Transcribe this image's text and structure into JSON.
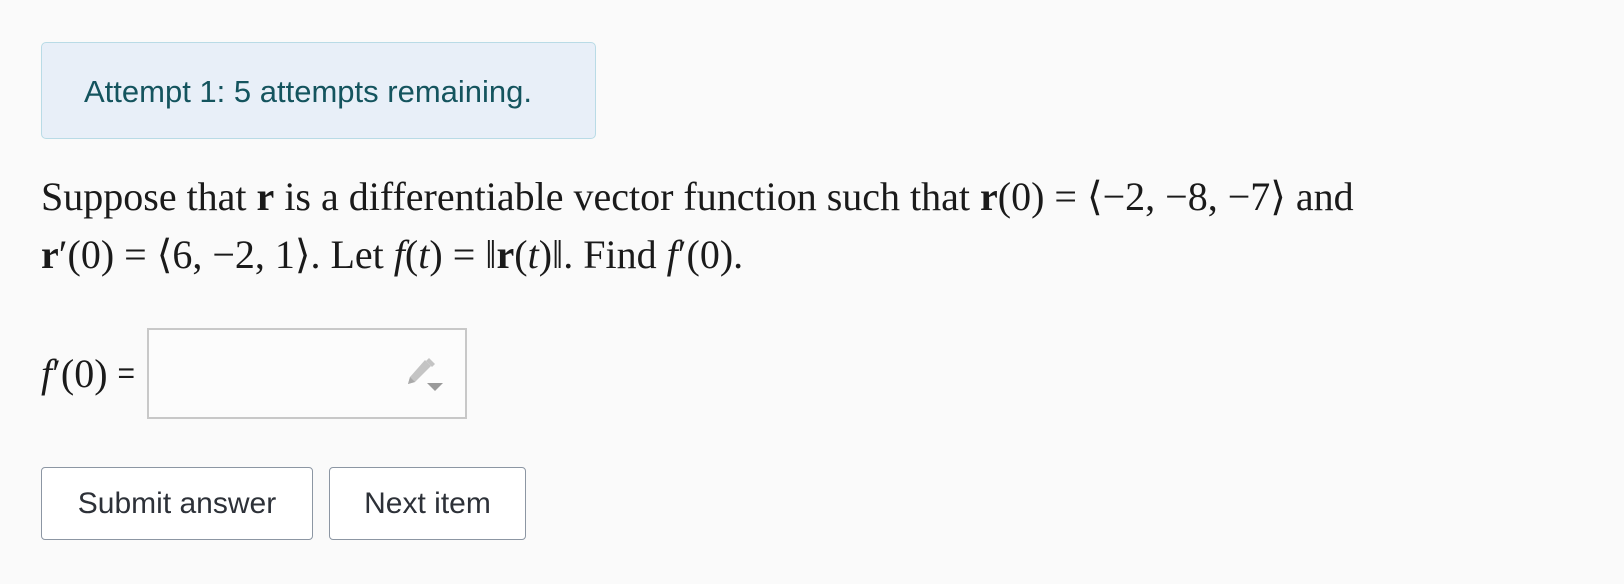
{
  "alert": {
    "text": "Attempt 1: 5 attempts remaining."
  },
  "question": {
    "line1": {
      "t1": "Suppose that ",
      "r1": "r",
      "t2": " is a differentiable vector function such that ",
      "r2": "r",
      "t3": "(0) = ⟨−2, −8, −7⟩ and"
    },
    "line2": {
      "r3": "r",
      "t4": "′(0) = ⟨6, −2, 1⟩. Let ",
      "f1": "f",
      "t5": "(",
      "tvar1": "t",
      "t6": ") = ‖",
      "r4": "r",
      "t7": "(",
      "tvar2": "t",
      "t8": ")‖. Find ",
      "f2": "f",
      "t9": "′(0)."
    }
  },
  "answer": {
    "label_f": "f",
    "label_rest": "′(0)",
    "equals": "=",
    "value": "",
    "placeholder": ""
  },
  "buttons": {
    "submit": "Submit answer",
    "next": "Next item"
  },
  "icons": {
    "editor": "pencil-dropdown-icon"
  },
  "colors": {
    "alert_bg": "#e8eff8",
    "alert_border": "#b9dbe6",
    "alert_text": "#14545e",
    "button_border": "#8c96a3"
  }
}
